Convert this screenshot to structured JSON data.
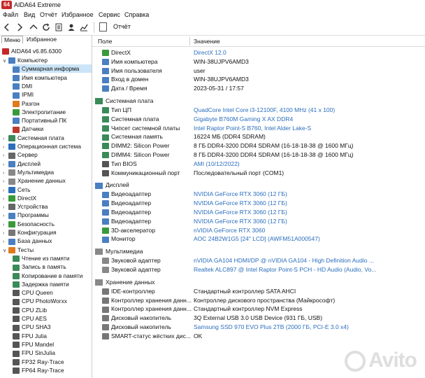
{
  "app": {
    "icon_text": "64",
    "title": "AIDA64 Extreme"
  },
  "menu": [
    "Файл",
    "Вид",
    "Отчёт",
    "Избранное",
    "Сервис",
    "Справка"
  ],
  "toolbar": {
    "report_label": "Отчёт"
  },
  "left": {
    "tabs": [
      "Меню",
      "Избранное"
    ],
    "root": "AIDA64 v6.85.6300",
    "tree": [
      {
        "label": "Компьютер",
        "level": 1,
        "exp": "v",
        "icon_color": "#4a7fc1"
      },
      {
        "label": "Суммарная информа",
        "level": 2,
        "exp": "",
        "icon_color": "#4a7fc1",
        "selected": true
      },
      {
        "label": "Имя компьютера",
        "level": 2,
        "exp": "",
        "icon_color": "#4a7fc1"
      },
      {
        "label": "DMI",
        "level": 2,
        "exp": "",
        "icon_color": "#4a7fc1"
      },
      {
        "label": "IPMI",
        "level": 2,
        "exp": "",
        "icon_color": "#4a7fc1"
      },
      {
        "label": "Разгон",
        "level": 2,
        "exp": "",
        "icon_color": "#e07a1f"
      },
      {
        "label": "Электропитание",
        "level": 2,
        "exp": "",
        "icon_color": "#3a9a3a"
      },
      {
        "label": "Портативный ПК",
        "level": 2,
        "exp": "",
        "icon_color": "#4a7fc1"
      },
      {
        "label": "Датчики",
        "level": 2,
        "exp": "",
        "icon_color": "#c0392b"
      },
      {
        "label": "Системная плата",
        "level": 1,
        "exp": ">",
        "icon_color": "#3a8a5a"
      },
      {
        "label": "Операционная система",
        "level": 1,
        "exp": ">",
        "icon_color": "#2a6ebd"
      },
      {
        "label": "Сервер",
        "level": 1,
        "exp": ">",
        "icon_color": "#666"
      },
      {
        "label": "Дисплей",
        "level": 1,
        "exp": ">",
        "icon_color": "#4a7fc1"
      },
      {
        "label": "Мультимедиа",
        "level": 1,
        "exp": ">",
        "icon_color": "#888"
      },
      {
        "label": "Хранение данных",
        "level": 1,
        "exp": ">",
        "icon_color": "#888"
      },
      {
        "label": "Сеть",
        "level": 1,
        "exp": ">",
        "icon_color": "#2a6ebd"
      },
      {
        "label": "DirectX",
        "level": 1,
        "exp": ">",
        "icon_color": "#3a9a3a"
      },
      {
        "label": "Устройства",
        "level": 1,
        "exp": ">",
        "icon_color": "#666"
      },
      {
        "label": "Программы",
        "level": 1,
        "exp": ">",
        "icon_color": "#4a7fc1"
      },
      {
        "label": "Безопасность",
        "level": 1,
        "exp": ">",
        "icon_color": "#3a9a3a"
      },
      {
        "label": "Конфигурация",
        "level": 1,
        "exp": ">",
        "icon_color": "#777"
      },
      {
        "label": "База данных",
        "level": 1,
        "exp": ">",
        "icon_color": "#4a7fc1"
      },
      {
        "label": "Тесты",
        "level": 1,
        "exp": "v",
        "icon_color": "#e07a1f"
      },
      {
        "label": "Чтение из памяти",
        "level": 2,
        "exp": "",
        "icon_color": "#3a8a5a"
      },
      {
        "label": "Запись в память",
        "level": 2,
        "exp": "",
        "icon_color": "#3a8a5a"
      },
      {
        "label": "Копирование в памяти",
        "level": 2,
        "exp": "",
        "icon_color": "#3a8a5a"
      },
      {
        "label": "Задержка памяти",
        "level": 2,
        "exp": "",
        "icon_color": "#3a8a5a"
      },
      {
        "label": "CPU Queen",
        "level": 2,
        "exp": "",
        "icon_color": "#555"
      },
      {
        "label": "CPU PhotoWorxx",
        "level": 2,
        "exp": "",
        "icon_color": "#555"
      },
      {
        "label": "CPU ZLib",
        "level": 2,
        "exp": "",
        "icon_color": "#555"
      },
      {
        "label": "CPU AES",
        "level": 2,
        "exp": "",
        "icon_color": "#555"
      },
      {
        "label": "CPU SHA3",
        "level": 2,
        "exp": "",
        "icon_color": "#555"
      },
      {
        "label": "FPU Julia",
        "level": 2,
        "exp": "",
        "icon_color": "#555"
      },
      {
        "label": "FPU Mandel",
        "level": 2,
        "exp": "",
        "icon_color": "#555"
      },
      {
        "label": "FPU SinJulia",
        "level": 2,
        "exp": "",
        "icon_color": "#555"
      },
      {
        "label": "FP32 Ray-Trace",
        "level": 2,
        "exp": "",
        "icon_color": "#555"
      },
      {
        "label": "FP64 Ray-Trace",
        "level": 2,
        "exp": "",
        "icon_color": "#555"
      }
    ]
  },
  "table": {
    "col_field": "Поле",
    "col_value": "Значение",
    "sections": [
      {
        "title": "",
        "rows": [
          {
            "field": "DirectX",
            "value": "DirectX 12.0",
            "link": true,
            "icon_color": "#3a9a3a"
          },
          {
            "field": "Имя компьютера",
            "value": "WIN-38UJPV6AMD3",
            "link": false,
            "icon_color": "#4a7fc1"
          },
          {
            "field": "Имя пользователя",
            "value": "user",
            "link": false,
            "icon_color": "#4a7fc1"
          },
          {
            "field": "Вход в домен",
            "value": "WIN-38UJPV6AMD3",
            "link": false,
            "icon_color": "#4a7fc1"
          },
          {
            "field": "Дата / Время",
            "value": "2023-05-31 / 17:57",
            "link": false,
            "icon_color": "#4a7fc1"
          }
        ]
      },
      {
        "title": "Системная плата",
        "icon_color": "#3a8a5a",
        "rows": [
          {
            "field": "Тип ЦП",
            "value": "QuadCore Intel Core i3-12100F, 4100 MHz (41 x 100)",
            "link": true,
            "icon_color": "#3a8a5a"
          },
          {
            "field": "Системная плата",
            "value": "Gigabyte B760M Gaming X AX DDR4",
            "link": true,
            "icon_color": "#3a8a5a"
          },
          {
            "field": "Чипсет системной платы",
            "value": "Intel Raptor Point-S B760, Intel Alder Lake-S",
            "link": true,
            "icon_color": "#3a8a5a"
          },
          {
            "field": "Системная память",
            "value": "16224 МБ  (DDR4 SDRAM)",
            "link": false,
            "icon_color": "#3a8a5a"
          },
          {
            "field": "DIMM2: Silicon Power",
            "value": "8 ГБ DDR4-3200 DDR4 SDRAM  (16-18-18-38 @ 1600 МГц)",
            "link": false,
            "icon_color": "#3a8a5a"
          },
          {
            "field": "DIMM4: Silicon Power",
            "value": "8 ГБ DDR4-3200 DDR4 SDRAM  (16-18-18-38 @ 1600 МГц)",
            "link": false,
            "icon_color": "#3a8a5a"
          },
          {
            "field": "Тип BIOS",
            "value": "AMI (10/12/2022)",
            "link": true,
            "icon_color": "#555"
          },
          {
            "field": "Коммуникационный порт",
            "value": "Последовательный порт (COM1)",
            "link": false,
            "icon_color": "#555"
          }
        ]
      },
      {
        "title": "Дисплей",
        "icon_color": "#4a7fc1",
        "rows": [
          {
            "field": "Видеоадаптер",
            "value": "NVIDIA GeForce RTX 3060  (12 ГБ)",
            "link": true,
            "icon_color": "#4a7fc1"
          },
          {
            "field": "Видеоадаптер",
            "value": "NVIDIA GeForce RTX 3060  (12 ГБ)",
            "link": true,
            "icon_color": "#4a7fc1"
          },
          {
            "field": "Видеоадаптер",
            "value": "NVIDIA GeForce RTX 3060  (12 ГБ)",
            "link": true,
            "icon_color": "#4a7fc1"
          },
          {
            "field": "Видеоадаптер",
            "value": "NVIDIA GeForce RTX 3060  (12 ГБ)",
            "link": true,
            "icon_color": "#4a7fc1"
          },
          {
            "field": "3D-акселератор",
            "value": "nVIDIA GeForce RTX 3060",
            "link": true,
            "icon_color": "#3a9a3a"
          },
          {
            "field": "Монитор",
            "value": "AOC 24B2W1G5  [24\" LCD]  (AWFM51A000547)",
            "link": true,
            "icon_color": "#4a7fc1"
          }
        ]
      },
      {
        "title": "Мультимедиа",
        "icon_color": "#888",
        "rows": [
          {
            "field": "Звуковой адаптер",
            "value": "nVIDIA GA104 HDMI/DP @ nVIDIA GA104 - High Definition Audio ...",
            "link": true,
            "icon_color": "#888"
          },
          {
            "field": "Звуковой адаптер",
            "value": "Realtek ALC897 @ Intel Raptor Point-S PCH - HD Audio (Audio, Vo...",
            "link": true,
            "icon_color": "#888"
          }
        ]
      },
      {
        "title": "Хранение данных",
        "icon_color": "#888",
        "rows": [
          {
            "field": "IDE-контроллер",
            "value": "Стандартный контроллер SATA AHCI",
            "link": false,
            "icon_color": "#777"
          },
          {
            "field": "Контроллер хранения данн...",
            "value": "Контроллер дискового пространства (Майкрософт)",
            "link": false,
            "icon_color": "#777"
          },
          {
            "field": "Контроллер хранения данн...",
            "value": "Стандартный контроллер NVM Express",
            "link": false,
            "icon_color": "#777"
          },
          {
            "field": "Дисковый накопитель",
            "value": "3Q External USB 3.0 USB Device  (931 ГБ, USB)",
            "link": false,
            "icon_color": "#777"
          },
          {
            "field": "Дисковый накопитель",
            "value": "Samsung SSD 970 EVO Plus 2TB  (2000 ГБ, PCI-E 3.0 x4)",
            "link": true,
            "icon_color": "#777"
          },
          {
            "field": "SMART-статус жёстких дис...",
            "value": "OK",
            "link": false,
            "icon_color": "#777"
          }
        ]
      }
    ]
  },
  "watermark": "Avito"
}
